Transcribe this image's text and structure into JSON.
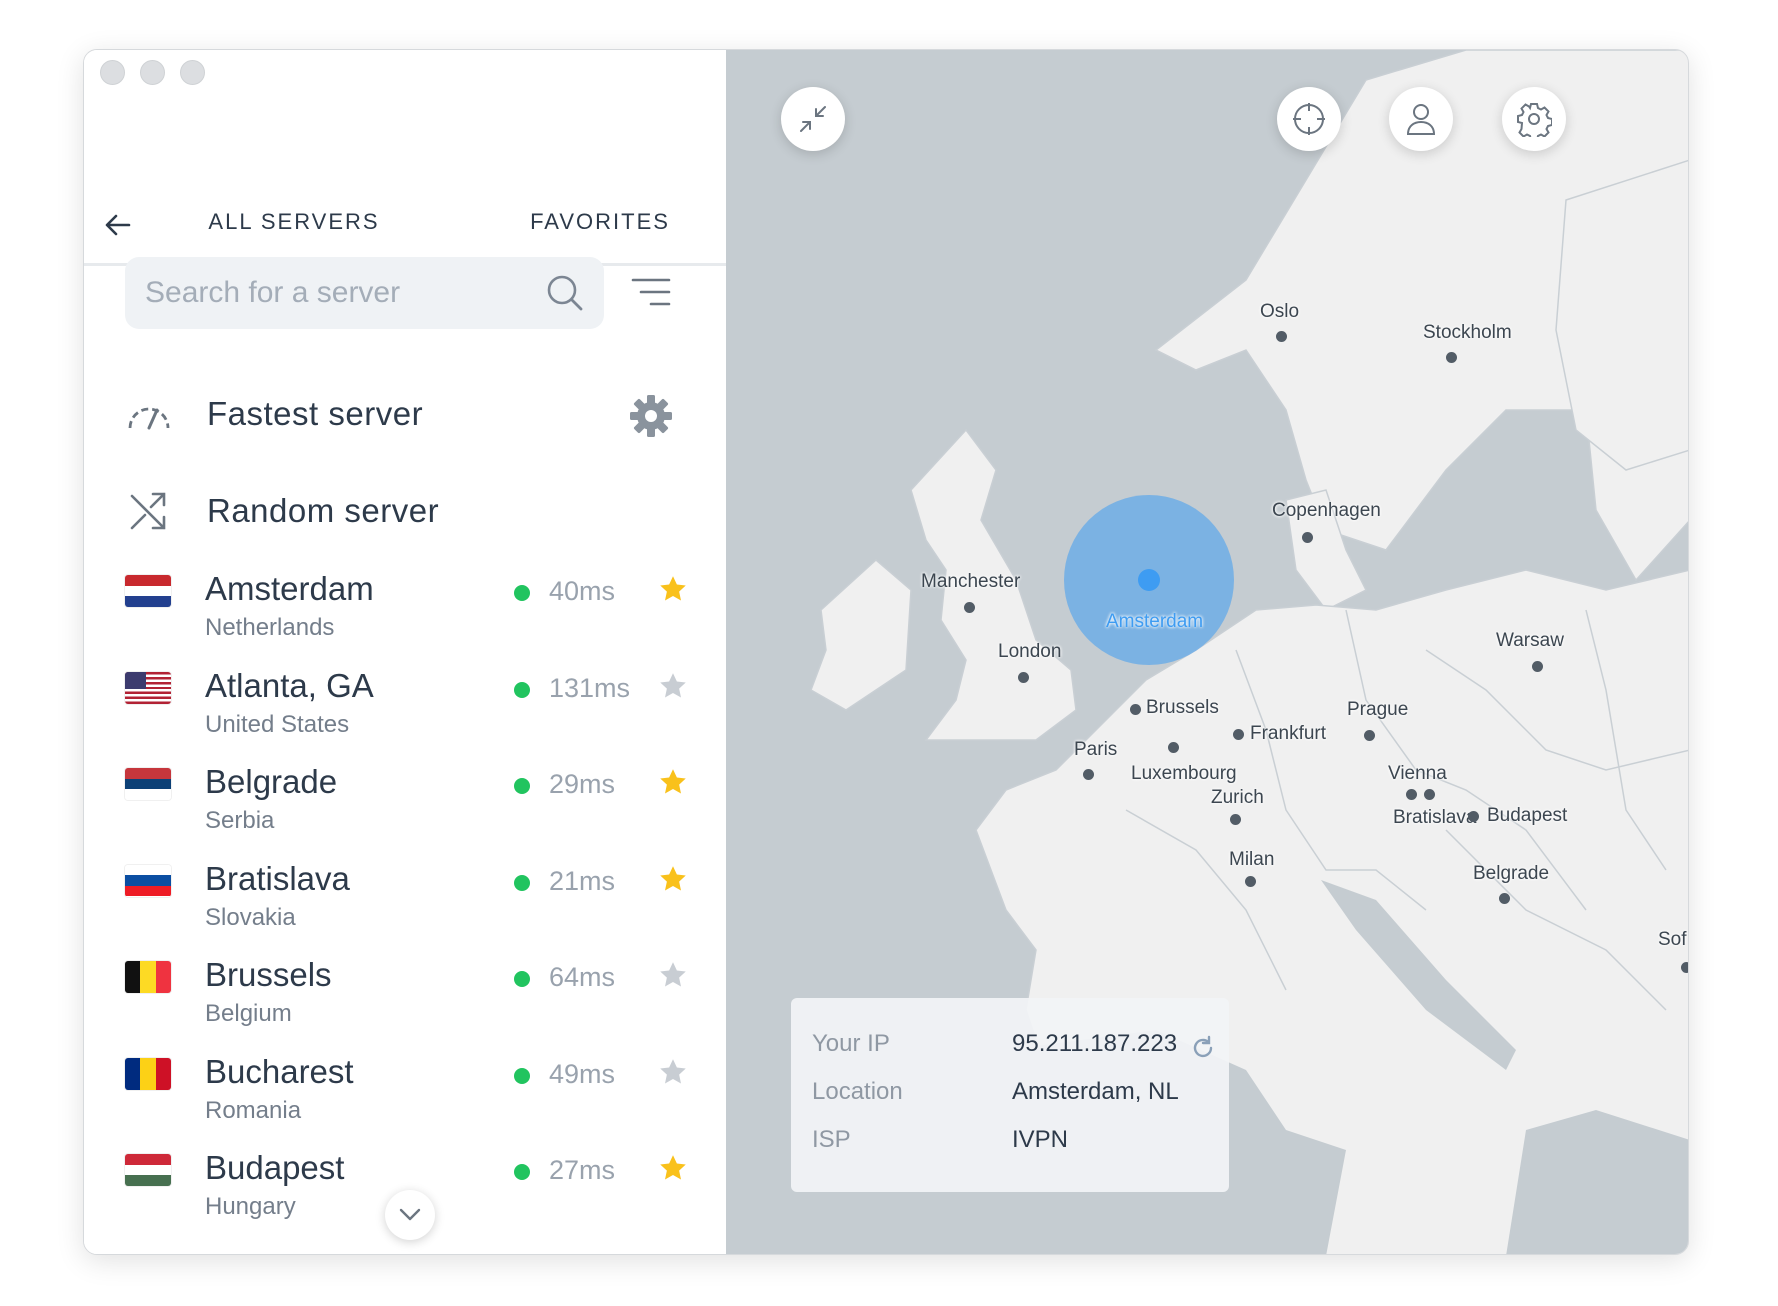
{
  "tabs": {
    "all_servers": "ALL SERVERS",
    "favorites": "FAVORITES"
  },
  "search": {
    "placeholder": "Search for a server"
  },
  "special": {
    "fastest": "Fastest server",
    "random": "Random server"
  },
  "servers": [
    {
      "city": "Amsterdam",
      "country": "Netherlands",
      "ping": "40ms",
      "favorite": true,
      "flag": "nl"
    },
    {
      "city": "Atlanta, GA",
      "country": "United States",
      "ping": "131ms",
      "favorite": false,
      "flag": "us"
    },
    {
      "city": "Belgrade",
      "country": "Serbia",
      "ping": "29ms",
      "favorite": true,
      "flag": "rs"
    },
    {
      "city": "Bratislava",
      "country": "Slovakia",
      "ping": "21ms",
      "favorite": true,
      "flag": "sk"
    },
    {
      "city": "Brussels",
      "country": "Belgium",
      "ping": "64ms",
      "favorite": false,
      "flag": "be"
    },
    {
      "city": "Bucharest",
      "country": "Romania",
      "ping": "49ms",
      "favorite": false,
      "flag": "ro"
    },
    {
      "city": "Budapest",
      "country": "Hungary",
      "ping": "27ms",
      "favorite": true,
      "flag": "hu"
    }
  ],
  "map": {
    "cities": [
      "Oslo",
      "Stockholm",
      "Copenhagen",
      "Manchester",
      "London",
      "Amsterdam",
      "Brussels",
      "Frankfurt",
      "Prague",
      "Warsaw",
      "Paris",
      "Luxembourg",
      "Zurich",
      "Vienna",
      "Bratislava",
      "Budapest",
      "Milan",
      "Belgrade",
      "Sof"
    ]
  },
  "connection": {
    "ip_label": "Your IP",
    "ip_value": "95.211.187.223",
    "location_label": "Location",
    "location_value": "Amsterdam, NL",
    "isp_label": "ISP",
    "isp_value": "IVPN"
  },
  "colors": {
    "accent": "#3e9cf2",
    "online": "#21c45f",
    "star_on": "#f9c11b",
    "star_off": "#c8cdd3",
    "sea": "#c5ccd1",
    "land": "#f0f0f0"
  }
}
